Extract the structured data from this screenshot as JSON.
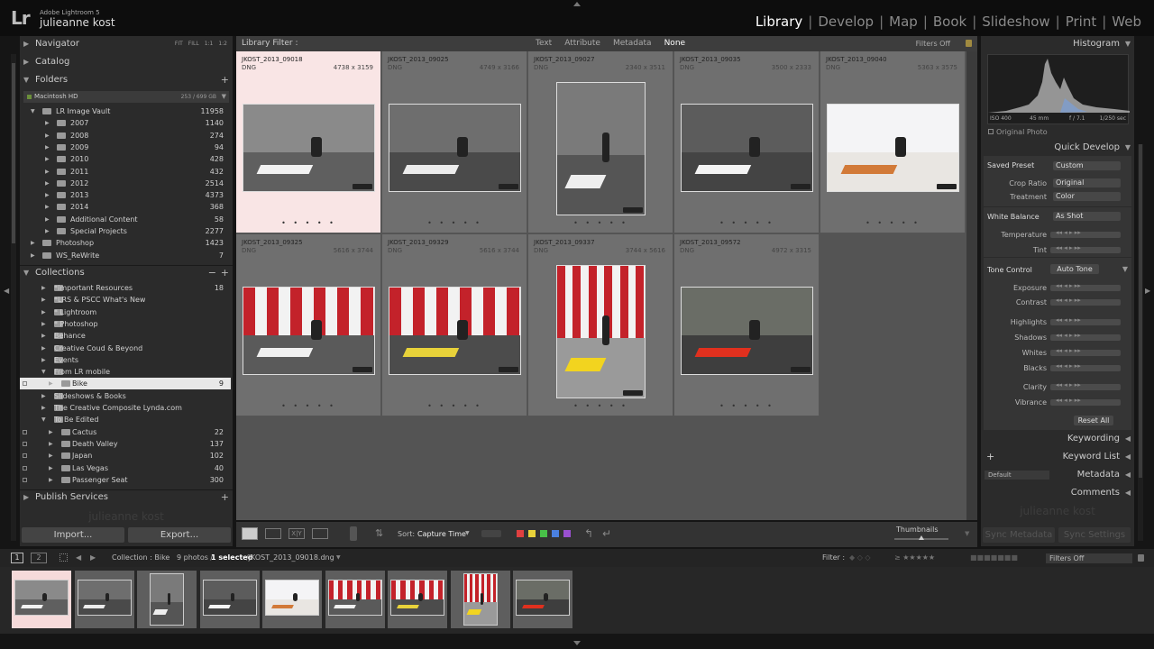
{
  "app": {
    "logo": "Lr",
    "name": "Adobe Lightroom 5",
    "user": "julieanne kost"
  },
  "modules": [
    {
      "label": "Library",
      "active": true
    },
    {
      "label": "Develop",
      "active": false
    },
    {
      "label": "Map",
      "active": false
    },
    {
      "label": "Book",
      "active": false
    },
    {
      "label": "Slideshow",
      "active": false
    },
    {
      "label": "Print",
      "active": false
    },
    {
      "label": "Web",
      "active": false
    }
  ],
  "left": {
    "navigator": {
      "label": "Navigator",
      "zoom": [
        "FIT",
        "FILL",
        "1:1",
        "1:2"
      ]
    },
    "catalog": {
      "label": "Catalog"
    },
    "folders": {
      "label": "Folders",
      "volume": {
        "name": "Macintosh HD",
        "space": "253 / 699 GB"
      },
      "items": [
        {
          "label": "LR Image Vault",
          "count": "11958",
          "level": 1
        },
        {
          "label": "2007",
          "count": "1140",
          "level": 2
        },
        {
          "label": "2008",
          "count": "274",
          "level": 2
        },
        {
          "label": "2009",
          "count": "94",
          "level": 2
        },
        {
          "label": "2010",
          "count": "428",
          "level": 2
        },
        {
          "label": "2011",
          "count": "432",
          "level": 2
        },
        {
          "label": "2012",
          "count": "2514",
          "level": 2
        },
        {
          "label": "2013",
          "count": "4373",
          "level": 2
        },
        {
          "label": "2014",
          "count": "368",
          "level": 2
        },
        {
          "label": "Additional Content",
          "count": "58",
          "level": 2
        },
        {
          "label": "Special Projects",
          "count": "2277",
          "level": 2
        },
        {
          "label": "Photoshop",
          "count": "1423",
          "level": 0
        },
        {
          "label": "WS_ReWrite",
          "count": "7",
          "level": 0
        }
      ]
    },
    "collections": {
      "label": "Collections",
      "items": [
        {
          "label": "*Important Resources",
          "count": "18",
          "level": 1,
          "sq": false
        },
        {
          "label": "*LRS & PSCC What's New",
          "count": "",
          "level": 1,
          "sq": false
        },
        {
          "label": "* Lightroom",
          "count": "",
          "level": 1,
          "sq": false
        },
        {
          "label": "* Photoshop",
          "count": "",
          "level": 1,
          "sq": false
        },
        {
          "label": "Behance",
          "count": "",
          "level": 1,
          "sq": false
        },
        {
          "label": "Creative Coud & Beyond",
          "count": "",
          "level": 1,
          "sq": false
        },
        {
          "label": "Events",
          "count": "",
          "level": 1,
          "sq": false
        },
        {
          "label": "From LR mobile",
          "count": "",
          "level": 1,
          "sq": false
        },
        {
          "label": "Bike",
          "count": "9",
          "level": 2,
          "sq": true,
          "selected": true
        },
        {
          "label": "Slideshows & Books",
          "count": "",
          "level": 1,
          "sq": false
        },
        {
          "label": "The Creative Composite Lynda.com",
          "count": "",
          "level": 1,
          "sq": false
        },
        {
          "label": "To Be Edited",
          "count": "",
          "level": 1,
          "sq": false
        },
        {
          "label": "Cactus",
          "count": "22",
          "level": 2,
          "sq": true
        },
        {
          "label": "Death Valley",
          "count": "137",
          "level": 2,
          "sq": true
        },
        {
          "label": "Japan",
          "count": "102",
          "level": 2,
          "sq": true
        },
        {
          "label": "Las Vegas",
          "count": "40",
          "level": 2,
          "sq": true
        },
        {
          "label": "Passenger Seat",
          "count": "300",
          "level": 2,
          "sq": true
        }
      ]
    },
    "publish": {
      "label": "Publish Services"
    },
    "watermark": "julieanne kost",
    "import_label": "Import...",
    "export_label": "Export..."
  },
  "filter": {
    "label": "Library Filter :",
    "options": [
      "Text",
      "Attribute",
      "Metadata",
      "None"
    ],
    "active": "None",
    "status": "Filters Off"
  },
  "photos": [
    {
      "name": "JKOST_2013_09018",
      "ext": "DNG",
      "dims": "4738 x 3159",
      "orient": "land",
      "selected": true,
      "colors": [
        "#8a8a8a",
        "#5f5f5f",
        "#f2f2f2"
      ]
    },
    {
      "name": "JKOST_2013_09025",
      "ext": "DNG",
      "dims": "4749 x 3166",
      "orient": "land",
      "colors": [
        "#6e6e6e",
        "#4a4a4a",
        "#ececec"
      ]
    },
    {
      "name": "JKOST_2013_09027",
      "ext": "DNG",
      "dims": "2340 x 3511",
      "orient": "port",
      "colors": [
        "#7a7a7a",
        "#555",
        "#eeeeee"
      ]
    },
    {
      "name": "JKOST_2013_09035",
      "ext": "DNG",
      "dims": "3500 x 2333",
      "orient": "land",
      "colors": [
        "#5c5c5c",
        "#444",
        "#f4f4f4"
      ]
    },
    {
      "name": "JKOST_2013_09040",
      "ext": "DNG",
      "dims": "5363 x 3575",
      "orient": "land",
      "colors": [
        "#f4f4f6",
        "#e9e6e2",
        "#d27a38"
      ]
    },
    {
      "name": "JKOST_2013_09325",
      "ext": "DNG",
      "dims": "5616 x 3744",
      "orient": "land",
      "colors": [
        "#c3222a",
        "#5a5a5a",
        "#f0f0f0"
      ]
    },
    {
      "name": "JKOST_2013_09329",
      "ext": "DNG",
      "dims": "5616 x 3744",
      "orient": "land",
      "colors": [
        "#c3222a",
        "#4c4c4c",
        "#e8d23a"
      ]
    },
    {
      "name": "JKOST_2013_09337",
      "ext": "DNG",
      "dims": "3744 x 5616",
      "orient": "port",
      "colors": [
        "#c3222a",
        "#9a9a9a",
        "#f2d41f"
      ]
    },
    {
      "name": "JKOST_2013_09572",
      "ext": "DNG",
      "dims": "4972 x 3315",
      "orient": "land",
      "colors": [
        "#6a6d66",
        "#3e3e3e",
        "#e0301e"
      ]
    }
  ],
  "toolbar": {
    "sort_label": "Sort:",
    "sort_value": "Capture Time",
    "thumbs_label": "Thumbnails",
    "label_colors": [
      "#e04040",
      "#e8d23a",
      "#48c048",
      "#4a80e0",
      "#9a50d0"
    ]
  },
  "right": {
    "histogram": {
      "label": "Histogram",
      "iso": "ISO 400",
      "focal": "45 mm",
      "fstop": "f / 7.1",
      "shutter": "1/250 sec",
      "original": "Original Photo"
    },
    "quick_develop": {
      "label": "Quick Develop",
      "saved_preset": {
        "label": "Saved Preset",
        "value": "Custom"
      },
      "crop_ratio": {
        "label": "Crop Ratio",
        "value": "Original"
      },
      "treatment": {
        "label": "Treatment",
        "value": "Color"
      },
      "white_balance": {
        "label": "White Balance",
        "value": "As Shot"
      },
      "wb_sliders": [
        "Temperature",
        "Tint"
      ],
      "tone_control": {
        "label": "Tone Control",
        "auto": "Auto Tone"
      },
      "tone_sliders": [
        "Exposure",
        "Contrast",
        "Highlights",
        "Shadows",
        "Whites",
        "Blacks",
        "Clarity",
        "Vibrance"
      ],
      "reset": "Reset All"
    },
    "keywording": "Keywording",
    "keyword_list": "Keyword List",
    "metadata": {
      "label": "Metadata",
      "preset": "Default"
    },
    "comments": "Comments",
    "watermark": "julieanne kost",
    "sync_metadata": "Sync Metadata",
    "sync_settings": "Sync Settings"
  },
  "filmbar": {
    "views": [
      "1",
      "2"
    ],
    "collection": "Collection : Bike",
    "count": "9 photos /",
    "selected": "1 selected",
    "file": "/JKOST_2013_09018.dng",
    "filter_label": "Filter :",
    "filter_status": "Filters Off"
  }
}
